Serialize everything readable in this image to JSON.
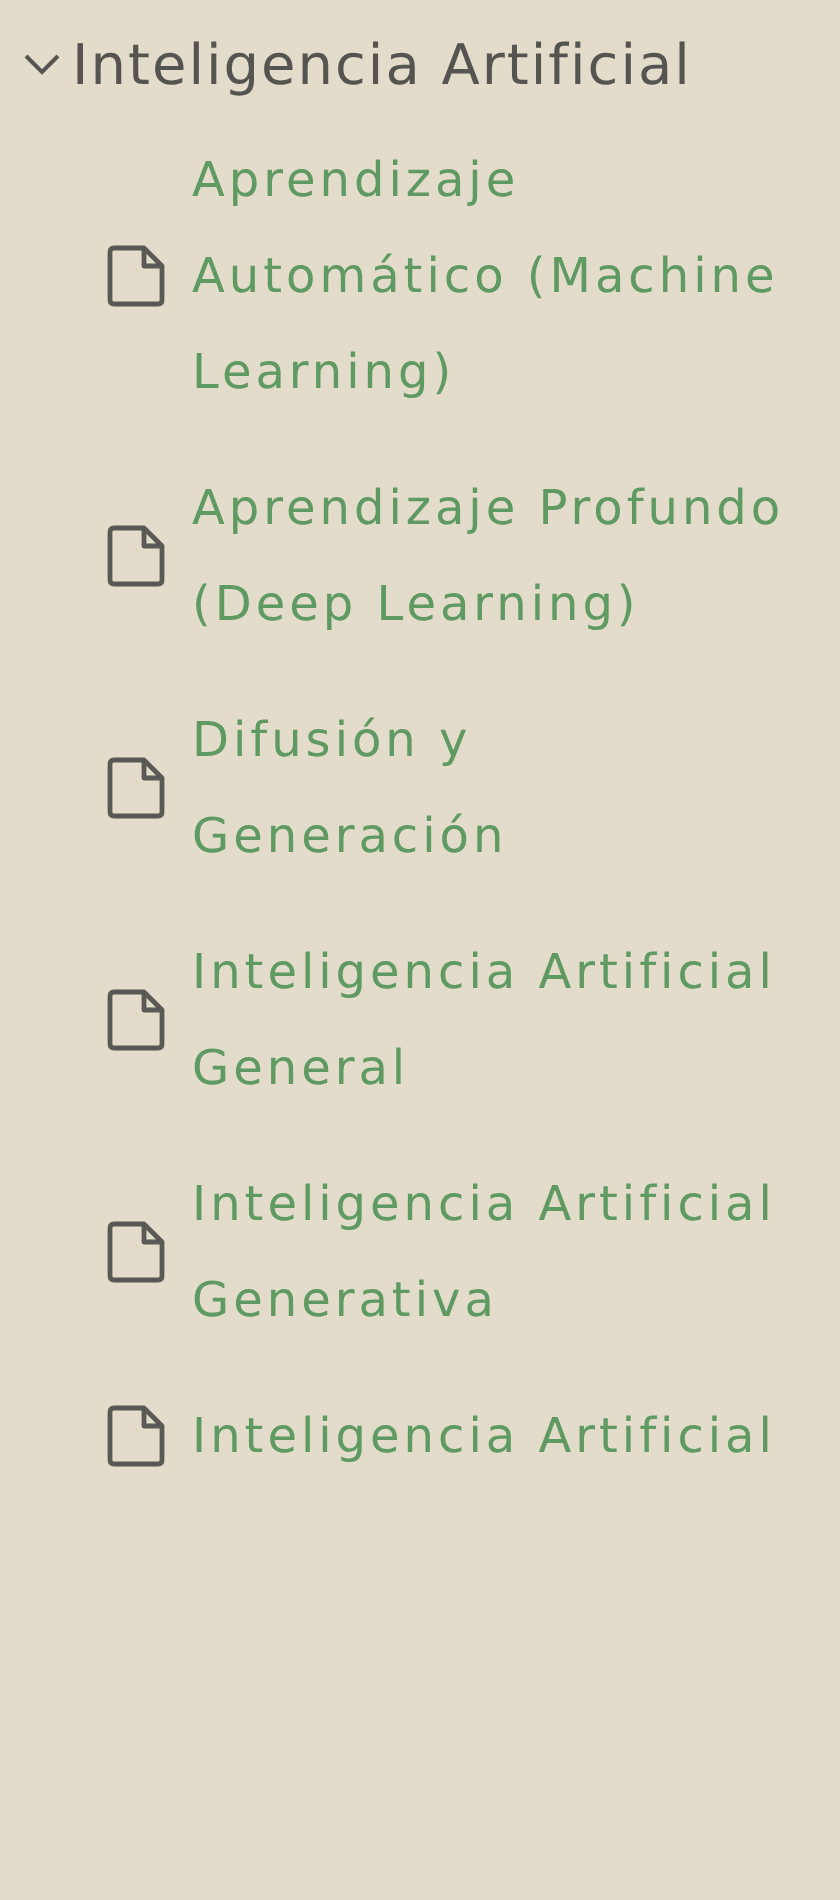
{
  "folder": {
    "title": "Inteligencia Artificial",
    "expanded": true,
    "children": [
      {
        "label": "Aprendizaje Automático (Machine Learning)"
      },
      {
        "label": "Aprendizaje Profundo (Deep Learning)"
      },
      {
        "label": "Difusión y Generación"
      },
      {
        "label": "Inteligencia Artificial General"
      },
      {
        "label": "Inteligencia Artificial Generativa"
      },
      {
        "label": "Inteligencia Artificial"
      }
    ]
  }
}
